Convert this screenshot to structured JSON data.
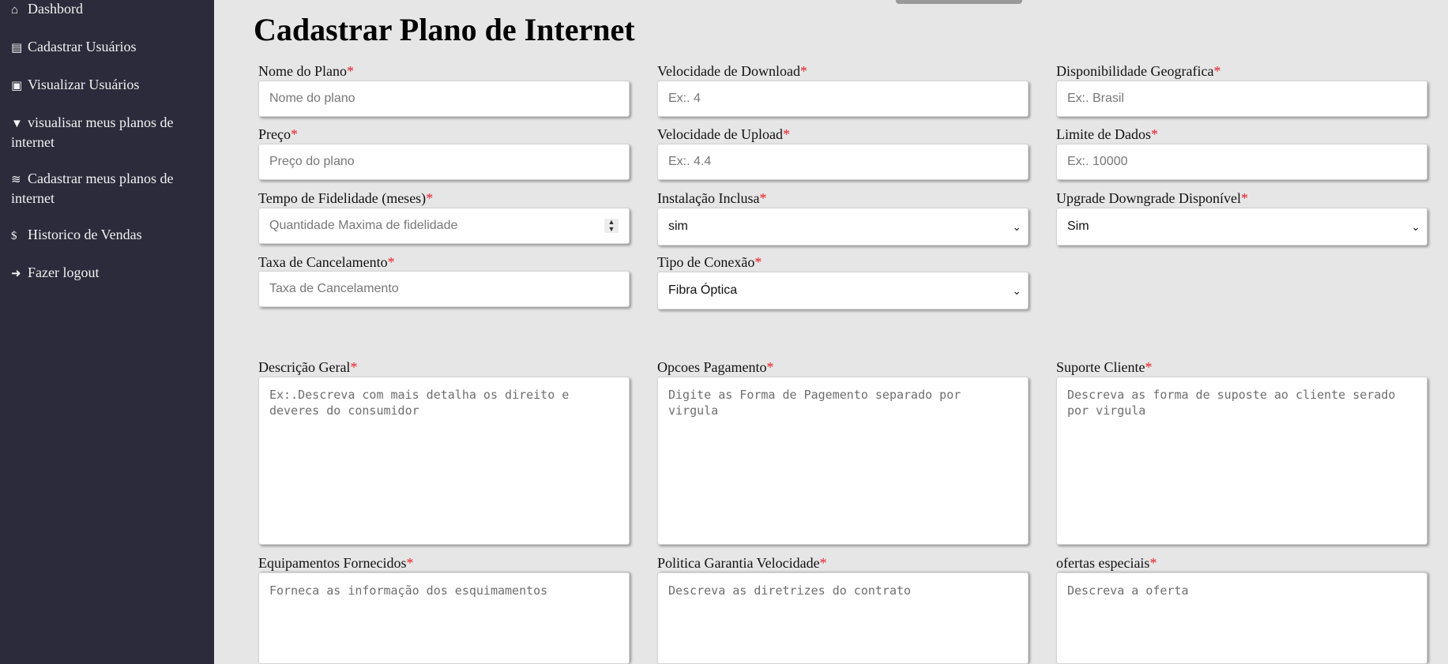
{
  "sidebar": {
    "items": [
      {
        "icon": "home-icon",
        "glyph": "⌂",
        "label": "Dashbord"
      },
      {
        "icon": "id-card-icon",
        "glyph": "▤",
        "label": "Cadastrar Usuários"
      },
      {
        "icon": "address-card-icon",
        "glyph": "▣",
        "label": "Visualizar Usuários"
      },
      {
        "icon": "wifi-icon",
        "glyph": "▼",
        "label": "visualisar meus planos de internet"
      },
      {
        "icon": "wifi-icon",
        "glyph": "≋",
        "label": "Cadastrar meus planos de internet"
      },
      {
        "icon": "dollar-circle-icon",
        "glyph": "$",
        "label": "Historico de Vendas"
      },
      {
        "icon": "logout-icon",
        "glyph": "➜",
        "label": "Fazer logout"
      }
    ]
  },
  "page": {
    "title": "Cadastrar Plano de Internet"
  },
  "required_mark": "*",
  "form": {
    "nome_plano": {
      "label": "Nome do Plano",
      "placeholder": "Nome do plano"
    },
    "velocidade_download": {
      "label": "Velocidade de Download",
      "placeholder": "Ex:. 4"
    },
    "disponibilidade": {
      "label": "Disponibilidade Geografica",
      "placeholder": "Ex:. Brasil"
    },
    "preco": {
      "label": "Preço",
      "placeholder": "Preço do plano"
    },
    "velocidade_upload": {
      "label": "Velocidade de Upload",
      "placeholder": "Ex:. 4.4"
    },
    "limite_dados": {
      "label": "Limite de Dados",
      "placeholder": "Ex:. 10000"
    },
    "tempo_fidelidade": {
      "label": "Tempo de Fidelidade (meses)",
      "placeholder": "Quantidade Maxima de fidelidade"
    },
    "instalacao": {
      "label": "Instalação Inclusa",
      "value": "sim"
    },
    "upgrade": {
      "label": "Upgrade Downgrade Disponível",
      "value": "Sim"
    },
    "taxa_cancelamento": {
      "label": "Taxa de Cancelamento",
      "placeholder": "Taxa de Cancelamento"
    },
    "tipo_conexao": {
      "label": "Tipo de Conexão",
      "value": "Fibra Óptica"
    },
    "descricao": {
      "label": "Descrição Geral",
      "placeholder": "Ex:.Descreva com mais detalha os direito e\ndeveres do consumidor"
    },
    "pagamento": {
      "label": "Opcoes Pagamento",
      "placeholder": "Digite as Forma de Pagemento separado por\nvirgula"
    },
    "suporte": {
      "label": "Suporte Cliente",
      "placeholder": "Descreva as forma de suposte ao cliente serado\npor virgula"
    },
    "equipamentos": {
      "label": "Equipamentos Fornecidos",
      "placeholder": "Forneca as informação dos esquimamentos"
    },
    "politica": {
      "label": "Politica Garantia Velocidade",
      "placeholder": "Descreva as diretrizes do contrato"
    },
    "ofertas": {
      "label": "ofertas especiais",
      "placeholder": "Descreva a oferta"
    }
  },
  "colors": {
    "sidebar_bg": "#2b2b3b",
    "page_bg": "#e6e6e6",
    "required": "#e8202a"
  }
}
